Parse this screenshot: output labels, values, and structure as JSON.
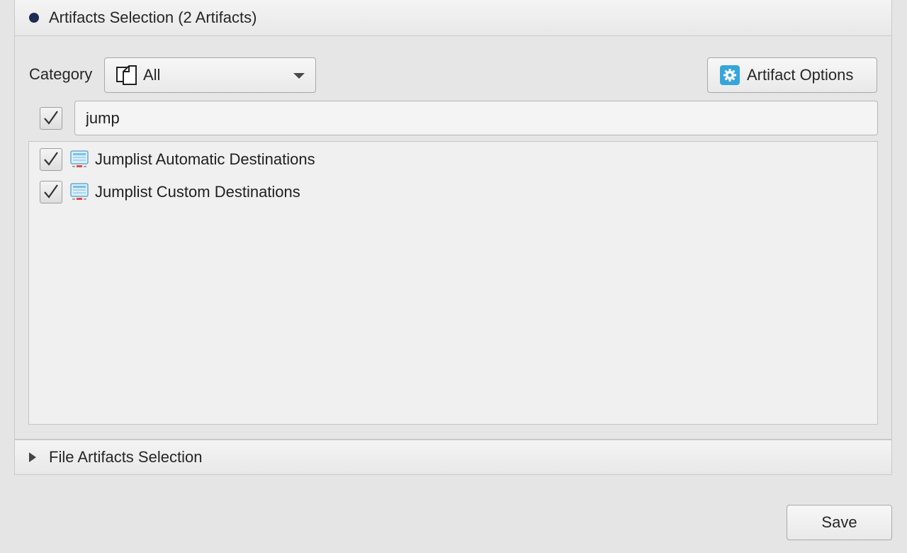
{
  "artifacts_panel": {
    "title": "Artifacts Selection (2 Artifacts)",
    "bullet_color": "#1e2b52"
  },
  "category": {
    "label": "Category",
    "selected": "All",
    "icon": "documents-icon"
  },
  "artifact_options": {
    "label": "Artifact Options",
    "icon": "gear-icon",
    "icon_color": "#35a6db"
  },
  "filter": {
    "checked": true,
    "value": "jump"
  },
  "artifacts": [
    {
      "label": "Jumplist Automatic Destinations",
      "checked": true,
      "icon": "computer-icon"
    },
    {
      "label": "Jumplist Custom Destinations",
      "checked": true,
      "icon": "computer-icon"
    }
  ],
  "file_artifacts_panel": {
    "title": "File Artifacts Selection",
    "expanded": false
  },
  "save_label": "Save"
}
